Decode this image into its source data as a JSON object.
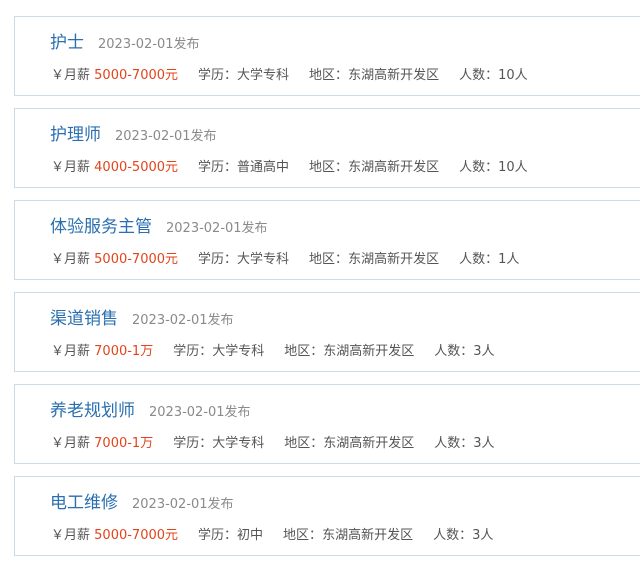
{
  "colors": {
    "title": "#2a6fb0",
    "salary": "#e2451c",
    "border": "#c9dbe7",
    "muted": "#8a8a8a"
  },
  "labels": {
    "salary": "￥月薪",
    "education": "学历：",
    "area": "地区：",
    "count": "人数："
  },
  "jobs": [
    {
      "title": "护士",
      "date": "2023-02-01发布",
      "salary": "5000-7000元",
      "education": "大学专科",
      "area": "东湖高新开发区",
      "count": "10人"
    },
    {
      "title": "护理师",
      "date": "2023-02-01发布",
      "salary": "4000-5000元",
      "education": "普通高中",
      "area": "东湖高新开发区",
      "count": "10人"
    },
    {
      "title": "体验服务主管",
      "date": "2023-02-01发布",
      "salary": "5000-7000元",
      "education": "大学专科",
      "area": "东湖高新开发区",
      "count": "1人"
    },
    {
      "title": "渠道销售",
      "date": "2023-02-01发布",
      "salary": "7000-1万",
      "education": "大学专科",
      "area": "东湖高新开发区",
      "count": "3人"
    },
    {
      "title": "养老规划师",
      "date": "2023-02-01发布",
      "salary": "7000-1万",
      "education": "大学专科",
      "area": "东湖高新开发区",
      "count": "3人"
    },
    {
      "title": "电工维修",
      "date": "2023-02-01发布",
      "salary": "5000-7000元",
      "education": "初中",
      "area": "东湖高新开发区",
      "count": "3人"
    }
  ]
}
